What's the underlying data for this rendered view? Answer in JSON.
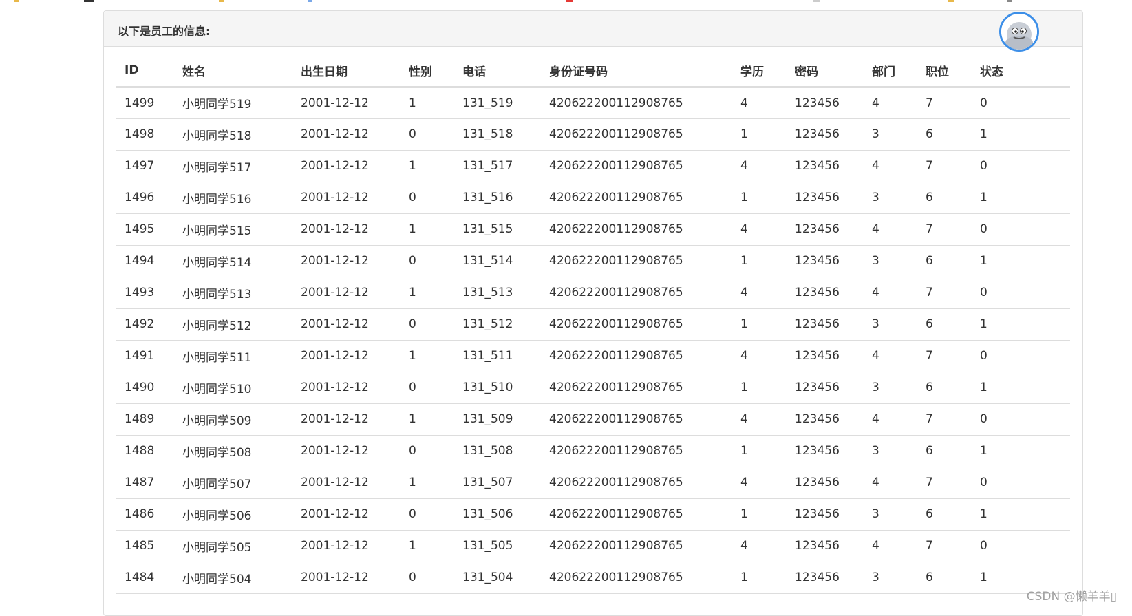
{
  "panel": {
    "title": "以下是员工的信息:"
  },
  "table": {
    "headers": [
      "ID",
      "姓名",
      "出生日期",
      "性别",
      "电话",
      "身份证号码",
      "学历",
      "密码",
      "部门",
      "职位",
      "状态"
    ],
    "rows": [
      [
        "1499",
        "小明同学519",
        "2001-12-12",
        "1",
        "131_519",
        "420622200112908765",
        "4",
        "123456",
        "4",
        "7",
        "0"
      ],
      [
        "1498",
        "小明同学518",
        "2001-12-12",
        "0",
        "131_518",
        "420622200112908765",
        "1",
        "123456",
        "3",
        "6",
        "1"
      ],
      [
        "1497",
        "小明同学517",
        "2001-12-12",
        "1",
        "131_517",
        "420622200112908765",
        "4",
        "123456",
        "4",
        "7",
        "0"
      ],
      [
        "1496",
        "小明同学516",
        "2001-12-12",
        "0",
        "131_516",
        "420622200112908765",
        "1",
        "123456",
        "3",
        "6",
        "1"
      ],
      [
        "1495",
        "小明同学515",
        "2001-12-12",
        "1",
        "131_515",
        "420622200112908765",
        "4",
        "123456",
        "4",
        "7",
        "0"
      ],
      [
        "1494",
        "小明同学514",
        "2001-12-12",
        "0",
        "131_514",
        "420622200112908765",
        "1",
        "123456",
        "3",
        "6",
        "1"
      ],
      [
        "1493",
        "小明同学513",
        "2001-12-12",
        "1",
        "131_513",
        "420622200112908765",
        "4",
        "123456",
        "4",
        "7",
        "0"
      ],
      [
        "1492",
        "小明同学512",
        "2001-12-12",
        "0",
        "131_512",
        "420622200112908765",
        "1",
        "123456",
        "3",
        "6",
        "1"
      ],
      [
        "1491",
        "小明同学511",
        "2001-12-12",
        "1",
        "131_511",
        "420622200112908765",
        "4",
        "123456",
        "4",
        "7",
        "0"
      ],
      [
        "1490",
        "小明同学510",
        "2001-12-12",
        "0",
        "131_510",
        "420622200112908765",
        "1",
        "123456",
        "3",
        "6",
        "1"
      ],
      [
        "1489",
        "小明同学509",
        "2001-12-12",
        "1",
        "131_509",
        "420622200112908765",
        "4",
        "123456",
        "4",
        "7",
        "0"
      ],
      [
        "1488",
        "小明同学508",
        "2001-12-12",
        "0",
        "131_508",
        "420622200112908765",
        "1",
        "123456",
        "3",
        "6",
        "1"
      ],
      [
        "1487",
        "小明同学507",
        "2001-12-12",
        "1",
        "131_507",
        "420622200112908765",
        "4",
        "123456",
        "4",
        "7",
        "0"
      ],
      [
        "1486",
        "小明同学506",
        "2001-12-12",
        "0",
        "131_506",
        "420622200112908765",
        "1",
        "123456",
        "3",
        "6",
        "1"
      ],
      [
        "1485",
        "小明同学505",
        "2001-12-12",
        "1",
        "131_505",
        "420622200112908765",
        "4",
        "123456",
        "4",
        "7",
        "0"
      ],
      [
        "1484",
        "小明同学504",
        "2001-12-12",
        "0",
        "131_504",
        "420622200112908765",
        "1",
        "123456",
        "3",
        "6",
        "1"
      ]
    ]
  },
  "avatar": {
    "icon": "cartoon-avatar-icon",
    "ring_color": "#3d8fe8"
  },
  "watermark": {
    "text": "CSDN @懒羊羊▯"
  },
  "colors": {
    "border": "#dddddd",
    "heading_bg": "#f5f5f5",
    "text": "#333333"
  }
}
